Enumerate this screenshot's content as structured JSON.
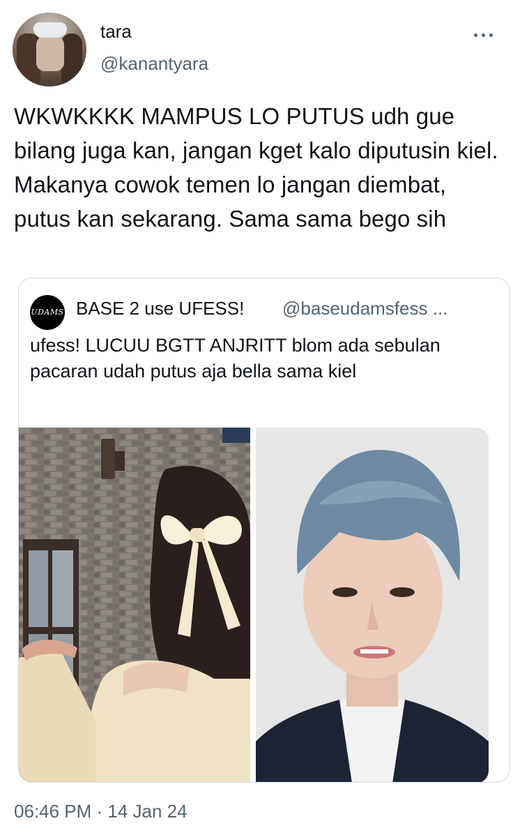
{
  "author": {
    "display_name": "tara",
    "handle": "@kanantyara"
  },
  "tweet": {
    "text": "WKWKKKK MAMPUS LO PUTUS udh gue bilang juga kan, jangan kget kalo diputusin kiel. Makanya cowok temen lo jangan diembat, putus kan sekarang. Sama sama bego sih",
    "timestamp": "06:46 PM · 14 Jan 24",
    "more_icon": "more-horizontal-icon"
  },
  "quoted_tweet": {
    "avatar_text": "UDAMS",
    "display_name": "BASE 2 use UFESS!",
    "handle": "@baseudamsfess ...",
    "text": "ufess! LUCUU BGTT ANJRITT blom ada sebulan pacaran udah putus aja bella sama kiel",
    "photo_count": 2
  },
  "colors": {
    "text_primary": "#0f1419",
    "text_secondary": "#536471",
    "border": "#cfd9de"
  }
}
